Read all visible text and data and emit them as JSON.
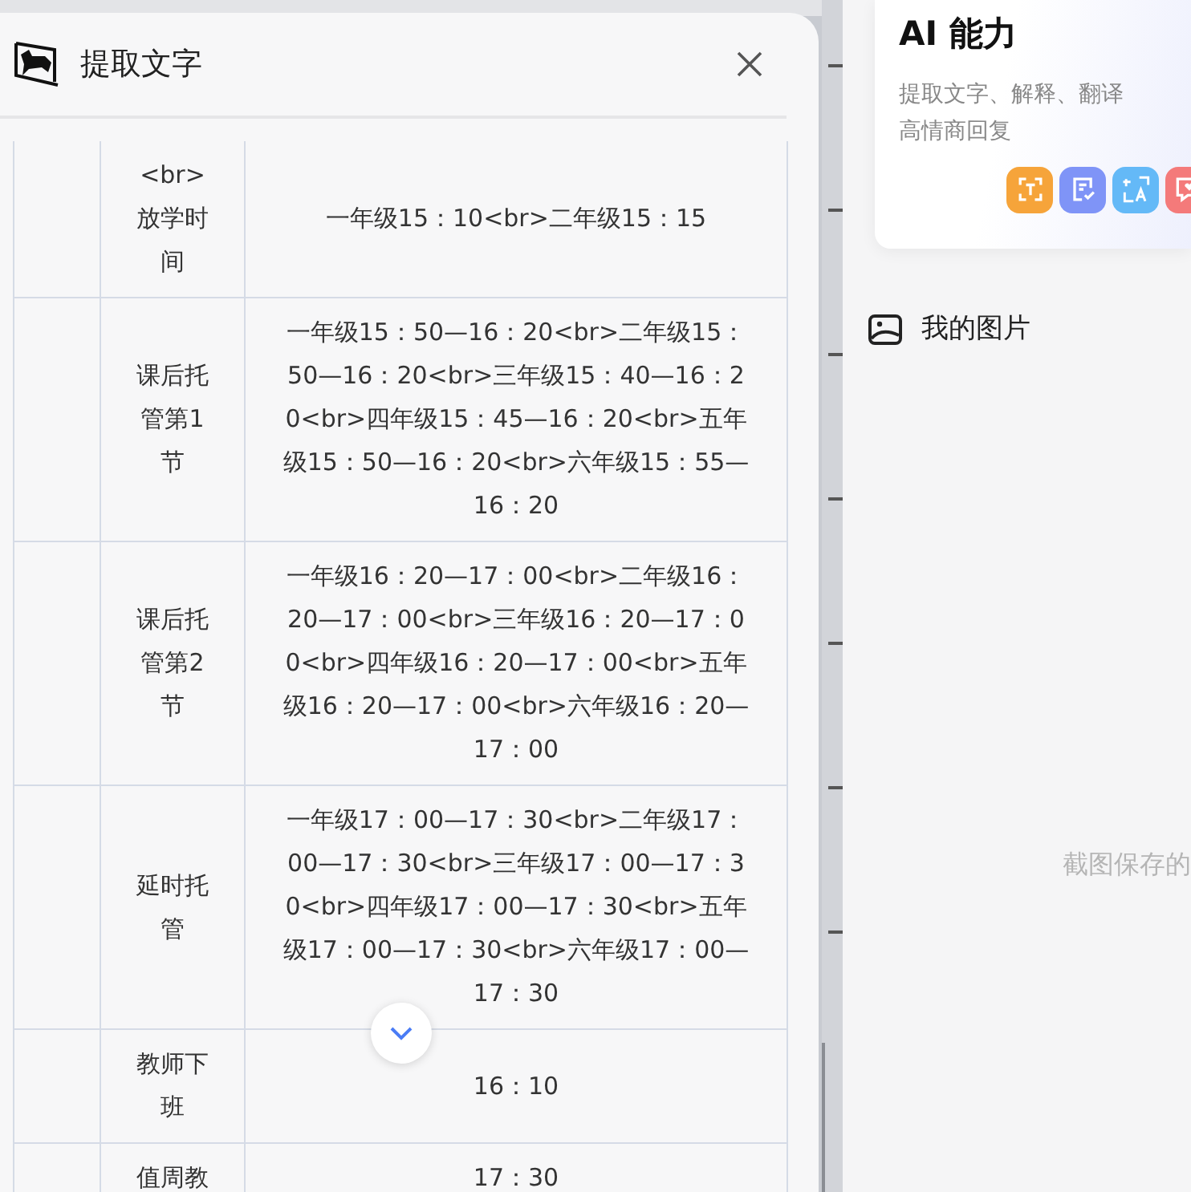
{
  "dialog": {
    "title": "提取文字"
  },
  "table": {
    "rows": [
      {
        "column_2": "<br>放学时间",
        "column_3": "一年级15：10<br>二年级15：15"
      },
      {
        "column_2": "课后托管第1节",
        "column_3": "一年级15：50—16：20<br>二年级15：50—16：20<br>三年级15：40—16：20<br>四年级15：45—16：20<br>五年级15：50—16：20<br>六年级15：55—16：20"
      },
      {
        "column_2": "课后托管第2节",
        "column_3": "一年级16：20—17：00<br>二年级16：20—17：00<br>三年级16：20—17：00<br>四年级16：20—17：00<br>五年级16：20—17：00<br>六年级16：20—17：00"
      },
      {
        "column_2": "延时托管",
        "column_3": "一年级17：00—17：30<br>二年级17：00—17：30<br>三年级17：00—17：30<br>四年级17：00—17：30<br>五年级17：00—17：30<br>六年级17：00—17：30"
      },
      {
        "column_2": "教师下班",
        "column_3": "16：10"
      },
      {
        "column_2": "值周教",
        "column_3": "17：30"
      }
    ]
  },
  "ai_card": {
    "title": "AI 能力",
    "description": "提取文字、解释、翻译高情商回复",
    "tools": [
      {
        "kind": "ocr",
        "color": "#f6a43a"
      },
      {
        "kind": "explain",
        "color": "#7f94f7"
      },
      {
        "kind": "translate",
        "color": "#64b9f7"
      },
      {
        "kind": "reply",
        "color": "#f47a7a"
      }
    ]
  },
  "my_pictures": {
    "label": "我的图片"
  },
  "empty_hint": "截图保存的"
}
